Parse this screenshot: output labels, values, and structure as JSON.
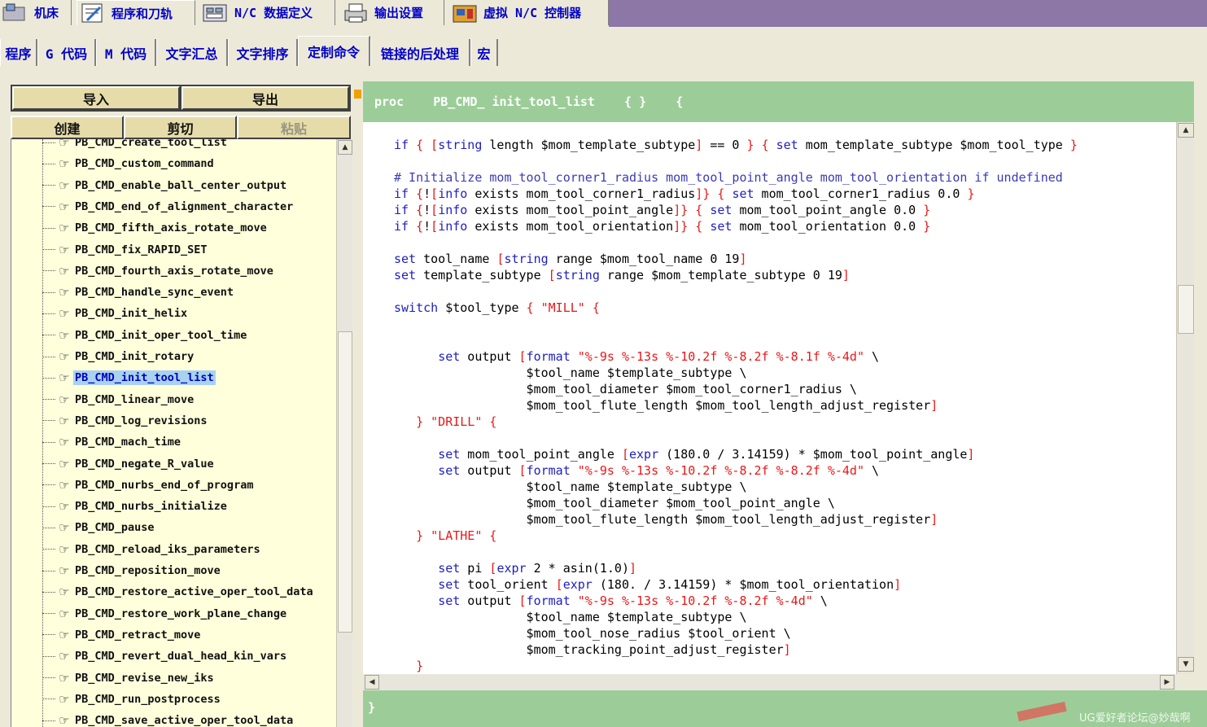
{
  "top_tabs": [
    {
      "label": "机床",
      "icon": "machine-icon"
    },
    {
      "label": "程序和刀轨",
      "icon": "program-icon",
      "active": true
    },
    {
      "label": "N/C 数据定义",
      "icon": "nc-data-icon"
    },
    {
      "label": "输出设置",
      "icon": "printer-icon"
    },
    {
      "label": "虚拟 N/C 控制器",
      "icon": "controller-icon"
    }
  ],
  "sub_tabs": [
    "程序",
    "G 代码",
    "M 代码",
    "文字汇总",
    "文字排序",
    "定制命令",
    "链接的后处理",
    "宏"
  ],
  "active_sub_tab": "定制命令",
  "buttons": {
    "import": "导入",
    "export": "导出",
    "create": "创建",
    "cut": "剪切",
    "paste": "粘贴"
  },
  "tree_items": [
    "PB_CMD_create_tool_list",
    "PB_CMD_custom_command",
    "PB_CMD_enable_ball_center_output",
    "PB_CMD_end_of_alignment_character",
    "PB_CMD_fifth_axis_rotate_move",
    "PB_CMD_fix_RAPID_SET",
    "PB_CMD_fourth_axis_rotate_move",
    "PB_CMD_handle_sync_event",
    "PB_CMD_init_helix",
    "PB_CMD_init_oper_tool_time",
    "PB_CMD_init_rotary",
    "PB_CMD_init_tool_list",
    "PB_CMD_linear_move",
    "PB_CMD_log_revisions",
    "PB_CMD_mach_time",
    "PB_CMD_negate_R_value",
    "PB_CMD_nurbs_end_of_program",
    "PB_CMD_nurbs_initialize",
    "PB_CMD_pause",
    "PB_CMD_reload_iks_parameters",
    "PB_CMD_reposition_move",
    "PB_CMD_restore_active_oper_tool_data",
    "PB_CMD_restore_work_plane_change",
    "PB_CMD_retract_move",
    "PB_CMD_revert_dual_head_kin_vars",
    "PB_CMD_revise_new_iks",
    "PB_CMD_run_postprocess",
    "PB_CMD_save_active_oper_tool_data"
  ],
  "selected_item": "PB_CMD_init_tool_list",
  "editor": {
    "header": "proc    PB_CMD_ init_tool_list    { }    {",
    "footer": "}",
    "code_lines": [
      "if { [string length $mom_template_subtype] == 0 } { set mom_template_subtype $mom_tool_type }",
      "",
      "# Initialize mom_tool_corner1_radius mom_tool_point_angle mom_tool_orientation if undefined",
      "if {![info exists mom_tool_corner1_radius]} { set mom_tool_corner1_radius 0.0 }",
      "if {![info exists mom_tool_point_angle]} { set mom_tool_point_angle 0.0 }",
      "if {![info exists mom_tool_orientation]} { set mom_tool_orientation 0.0 }",
      "",
      "set tool_name [string range $mom_tool_name 0 19]",
      "set template_subtype [string range $mom_template_subtype 0 19]",
      "",
      "switch $tool_type { \"MILL\" {",
      "",
      "",
      "      set output [format \"%-9s %-13s %-10.2f %-8.2f %-8.1f %-4d\" \\",
      "                  $tool_name $template_subtype \\",
      "                  $mom_tool_diameter $mom_tool_corner1_radius \\",
      "                  $mom_tool_flute_length $mom_tool_length_adjust_register]",
      "   } \"DRILL\" {",
      "",
      "      set mom_tool_point_angle [expr (180.0 / 3.14159) * $mom_tool_point_angle]",
      "      set output [format \"%-9s %-13s %-10.2f %-8.2f %-8.2f %-4d\" \\",
      "                  $tool_name $template_subtype \\",
      "                  $mom_tool_diameter $mom_tool_point_angle \\",
      "                  $mom_tool_flute_length $mom_tool_length_adjust_register]",
      "   } \"LATHE\" {",
      "",
      "      set pi [expr 2 * asin(1.0)]",
      "      set tool_orient [expr (180. / 3.14159) * $mom_tool_orientation]",
      "      set output [format \"%-9s %-13s %-10.2f %-8.2f %-4d\" \\",
      "                  $tool_name $template_subtype \\",
      "                  $mom_tool_nose_radius $tool_orient \\",
      "                  $mom_tracking_point_adjust_register]",
      "   }"
    ]
  },
  "watermark": "UG爱好者论坛@妙哉啊",
  "colors": {
    "accent_purple": "#8d77a6",
    "editor_green": "#9ccd98",
    "tree_bg": "#ffffdc",
    "keyword_blue": "#2020c0",
    "string_red": "#e81818"
  }
}
